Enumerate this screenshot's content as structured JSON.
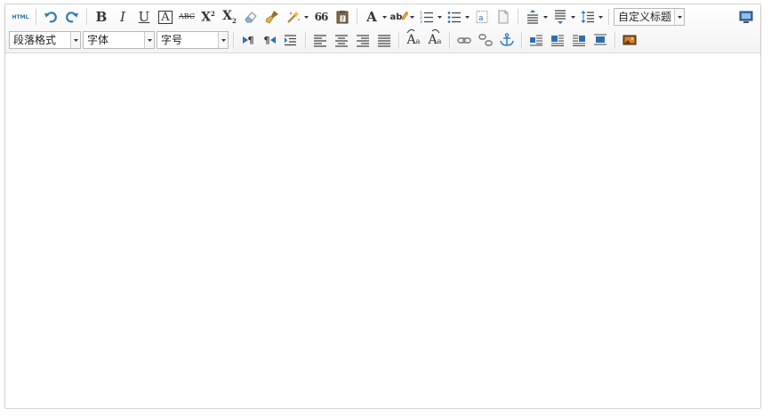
{
  "toolbar": {
    "source_label": "HTML",
    "bold_label": "B",
    "italic_label": "I",
    "underline_label": "U",
    "border_char_label": "A",
    "strike_label": "ABC",
    "superscript_label": "X",
    "superscript_sup": "2",
    "subscript_label": "X",
    "subscript_sub": "2",
    "quote_label": "66",
    "font_color_label": "A",
    "bg_color_label": "ab",
    "custom_heading": "自定义标题",
    "paragraph_select": "段落格式",
    "font_family_select": "字体",
    "font_size_select": "字号",
    "ltr_label": "¶",
    "rtl_label": "¶",
    "upper_label": "A",
    "lower_label": "A",
    "upper_sub": "a",
    "lower_sub": "a"
  },
  "content": {
    "body_text": ""
  },
  "colors": {
    "icon_blue": "#2f7bbd",
    "icon_dark": "#333333",
    "border": "#d4d4d4"
  }
}
